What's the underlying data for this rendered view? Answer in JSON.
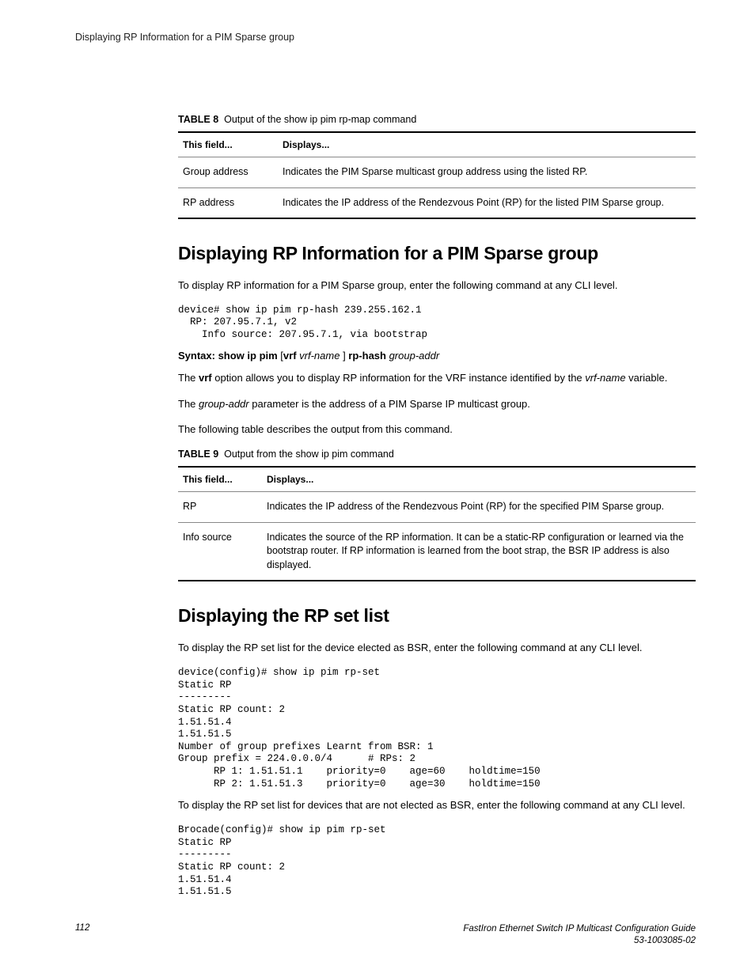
{
  "runningHeader": "Displaying RP Information for a PIM Sparse group",
  "table8": {
    "captionLabel": "TABLE 8",
    "captionText": "Output of the show ip pim rp-map command",
    "header1": "This field...",
    "header2": "Displays...",
    "rows": [
      {
        "field": "Group address",
        "desc": "Indicates the PIM Sparse multicast group address using the listed RP."
      },
      {
        "field": "RP address",
        "desc": "Indicates the IP address of the Rendezvous Point (RP) for the listed PIM Sparse group."
      }
    ]
  },
  "section1": {
    "heading": "Displaying RP Information for a PIM Sparse group",
    "intro": "To display RP information for a PIM Sparse group, enter the following command at any CLI level.",
    "code": "device# show ip pim rp-hash 239.255.162.1\n  RP: 207.95.7.1, v2\n    Info source: 207.95.7.1, via bootstrap",
    "syntax": {
      "prefix": "Syntax: show ip pim",
      "open": " [",
      "vrf": "vrf",
      "vrfname": " vrf-name ",
      "close": "] ",
      "rphash": "rp-hash",
      "groupaddr": " group-addr"
    },
    "vrfPara": {
      "p1": "The ",
      "b1": "vrf",
      "p2": " option allows you to display RP information for the VRF instance identified by the ",
      "i1": "vrf-name",
      "p3": " variable."
    },
    "groupPara": {
      "p1": "The ",
      "i1": "group-addr",
      "p2": " parameter is the address of a PIM Sparse IP multicast group."
    },
    "outro": "The following table describes the output from this command."
  },
  "table9": {
    "captionLabel": "TABLE 9",
    "captionText": "Output from the show ip pim command",
    "header1": "This field...",
    "header2": "Displays...",
    "rows": [
      {
        "field": "RP",
        "desc": "Indicates the IP address of the Rendezvous Point (RP) for the specified PIM Sparse group."
      },
      {
        "field": "Info source",
        "desc": "Indicates the source of the RP information. It can be a static-RP configuration or learned via the bootstrap router. If RP information is learned from the boot strap, the BSR IP address is also displayed."
      }
    ]
  },
  "section2": {
    "heading": "Displaying the RP set list",
    "intro": "To display the RP set list for the device elected as BSR, enter the following command at any CLI level.",
    "code1": "device(config)# show ip pim rp-set\nStatic RP\n---------\nStatic RP count: 2\n1.51.51.4\n1.51.51.5\nNumber of group prefixes Learnt from BSR: 1\nGroup prefix = 224.0.0.0/4      # RPs: 2\n      RP 1: 1.51.51.1    priority=0    age=60    holdtime=150\n      RP 2: 1.51.51.3    priority=0    age=30    holdtime=150",
    "mid": "To display the RP set list for devices that are not elected as BSR, enter the following command at any CLI level.",
    "code2": "Brocade(config)# show ip pim rp-set\nStatic RP\n---------\nStatic RP count: 2\n1.51.51.4\n1.51.51.5"
  },
  "footer": {
    "pageNum": "112",
    "title": "FastIron Ethernet Switch IP Multicast Configuration Guide",
    "docnum": "53-1003085-02"
  }
}
